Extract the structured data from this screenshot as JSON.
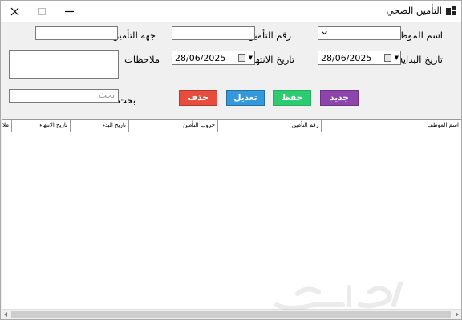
{
  "window": {
    "title": "التأمين الصحي",
    "icon": "window-app-icon",
    "controls": [
      "minimize-icon",
      "maximize-icon",
      "close-icon"
    ]
  },
  "form": {
    "employee_label": "اسم الموظف",
    "insurance_number_label": "رقم التأمين",
    "insurance_provider_label": "جهة التأمين",
    "start_date_label": "تاريخ البداية",
    "end_date_label": "تاريخ الانتهاء",
    "notes_label": "ملاحظات",
    "search_label": "بحث",
    "start_date_value": "28/06/2025",
    "end_date_value": "28/06/2025",
    "employee_value": "",
    "insurance_number_value": "",
    "insurance_provider_value": "",
    "notes_value": "",
    "search_placeholder": "بحث"
  },
  "buttons": {
    "new": {
      "label": "جديد",
      "color": "#8e44ad"
    },
    "save": {
      "label": "حفظ",
      "color": "#2ecc71"
    },
    "edit": {
      "label": "تعديل",
      "color": "#3498db"
    },
    "delete": {
      "label": "حذف",
      "color": "#e74c3c"
    }
  },
  "grid": {
    "columns": [
      "اسم الموظف",
      "رقم التأمين",
      "جروب التأمين",
      "تاريخ البدء",
      "تاريخ الانتهاء",
      "ملاحظات"
    ],
    "rows": []
  },
  "watermark": {
    "text": "حراج"
  }
}
